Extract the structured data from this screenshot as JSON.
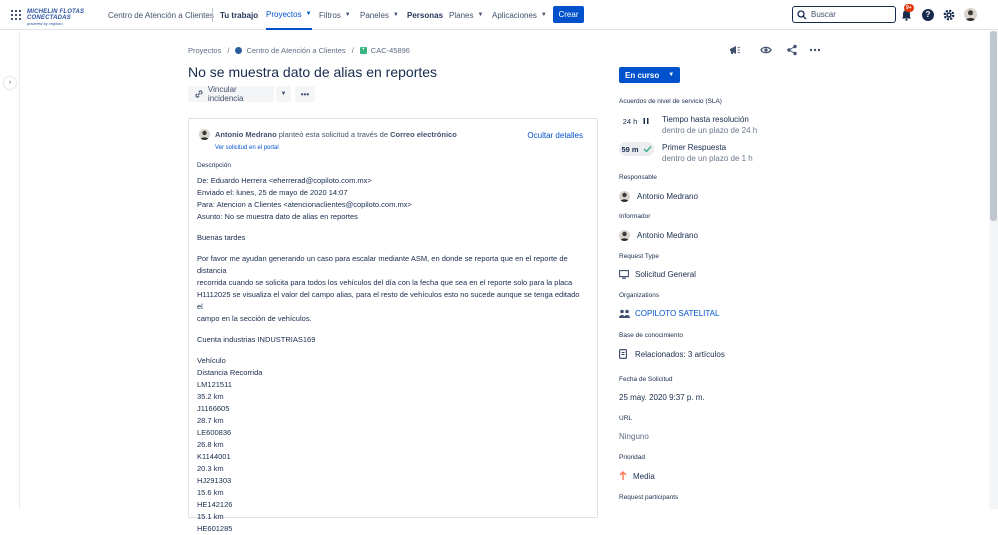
{
  "topbar": {
    "logo_line1": "MICHELIN FLOTAS CONECTADAS",
    "logo_line2": "powered by copiloto",
    "project_name": "Centro de Atención a Clientes",
    "nav": [
      {
        "label": "Tu trabajo",
        "has_chevron": false
      },
      {
        "label": "Proyectos",
        "has_chevron": true
      },
      {
        "label": "Filtros",
        "has_chevron": true
      },
      {
        "label": "Paneles",
        "has_chevron": true
      },
      {
        "label": "Personas",
        "has_chevron": false
      },
      {
        "label": "Planes",
        "has_chevron": true
      },
      {
        "label": "Aplicaciones",
        "has_chevron": true
      }
    ],
    "create_label": "Crear",
    "search_placeholder": "Buscar",
    "notif_badge": "9+",
    "help_glyph": "?"
  },
  "breadcrumb": {
    "items": [
      "Proyectos",
      "Centro de Atención a Clientes",
      "CAC-45896"
    ]
  },
  "issue": {
    "title": "No se muestra dato de alias en reportes",
    "link_issue_label": "Vincular incidencia",
    "more_label": "•••"
  },
  "request": {
    "author": "Antonio Medrano",
    "raised_via": "planteó esta solicitud a través de",
    "channel": "Correo electrónico",
    "hide_details": "Ocultar detalles",
    "view_portal": "Ver solicitud en el portal",
    "description_label": "Descripción",
    "description": [
      [
        "De: Eduardo Herrera <eherrerad@copiloto.com.mx>",
        "Enviado el: lunes, 25 de mayo de 2020 14:07",
        "Para: Atencion a Clientes <atencionaclientes@copiloto.com.mx>",
        "Asunto: No se muestra dato de alias en reportes"
      ],
      [
        "Buenas tardes"
      ],
      [
        "Por favor me ayudan generando un caso para escalar mediante ASM, en donde se reporta que en el reporte de distancia",
        "recorrida cuando se solicita para todos los vehículos del día con la fecha que sea en el reporte solo para la placa",
        "H1112025 se visualiza el valor del campo alias, para el resto de vehículos esto no sucede aunque se tenga editado el",
        "campo en la sección de vehículos."
      ],
      [
        "Cuenta industrias INDUSTRIAS169"
      ],
      [
        "Vehículo",
        "Distancia Recorrida",
        "LM121511",
        "35.2 km",
        "J1166605",
        "28.7 km",
        "LE600836",
        "26.8 km",
        "K1144001",
        "20.3 km",
        "HJ291303",
        "15.6 km",
        "HE142126",
        "15.1 km",
        "HE601285"
      ]
    ]
  },
  "sidebar": {
    "status": "En curso",
    "sla_label": "Acuerdos de nivel de servicio (SLA)",
    "sla": [
      {
        "chip": "24 h",
        "icon": "pause-icon",
        "name": "Tiempo hasta resolución",
        "sub": "dentro de un plazo de 24 h",
        "chip_bg": "#ffffff",
        "chip_color": "#172b4d"
      },
      {
        "chip": "59 m",
        "icon": "check-icon",
        "name": "Primer Respuesta",
        "sub": "dentro de un plazo de 1 h",
        "chip_bg": "#ebecf0",
        "chip_color": "#172b4d"
      }
    ],
    "fields": [
      {
        "label": "Responsable",
        "value": "Antonio Medrano",
        "icon": "avatar"
      },
      {
        "label": "Informador",
        "value": "Antonio Medrano",
        "icon": "avatar"
      },
      {
        "label": "Request Type",
        "value": "Solicitud General",
        "icon": "monitor-icon"
      },
      {
        "label": "Organizations",
        "value": "COPILOTO SATELITAL",
        "icon": "organization-icon"
      },
      {
        "label": "Base de conocimiento",
        "value": "Relacionados: 3 artículos",
        "icon": "book-icon"
      },
      {
        "label": "Fecha de Solicitud",
        "value": "25 may. 2020 9:37 p. m.",
        "icon": ""
      },
      {
        "label": "URL",
        "value": "Ninguno",
        "icon": ""
      },
      {
        "label": "Prioridad",
        "value": "Media",
        "icon": "arrow-up-icon"
      },
      {
        "label": "Request participants",
        "value": "",
        "icon": ""
      }
    ]
  },
  "colors": {
    "primary": "#0052cc",
    "text": "#172b4d",
    "muted": "#5e6c84",
    "priority": "#ff7452"
  }
}
